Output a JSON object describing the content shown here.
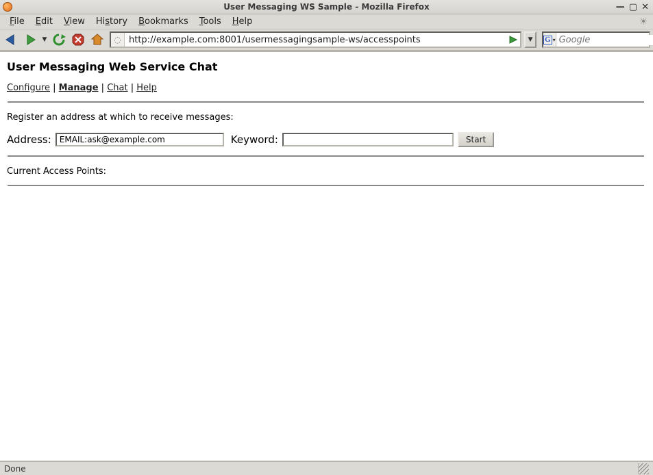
{
  "window": {
    "title": "User Messaging WS Sample - Mozilla Firefox"
  },
  "menubar": [
    "File",
    "Edit",
    "View",
    "History",
    "Bookmarks",
    "Tools",
    "Help"
  ],
  "urlbar": {
    "value": "http://example.com:8001/usermessagingsample-ws/accesspoints"
  },
  "search": {
    "placeholder": "Google"
  },
  "page": {
    "heading": "User Messaging Web Service Chat",
    "nav": {
      "configure": "Configure",
      "manage": "Manage",
      "chat": "Chat",
      "help": "Help",
      "sep": " | "
    },
    "register_text": "Register an address at which to receive messages:",
    "form": {
      "address_label": "Address:",
      "address_value": "EMAIL:ask@example.com",
      "keyword_label": "Keyword:",
      "keyword_value": "",
      "start_label": "Start"
    },
    "current_access_points_label": "Current Access Points:"
  },
  "status": {
    "text": "Done"
  }
}
